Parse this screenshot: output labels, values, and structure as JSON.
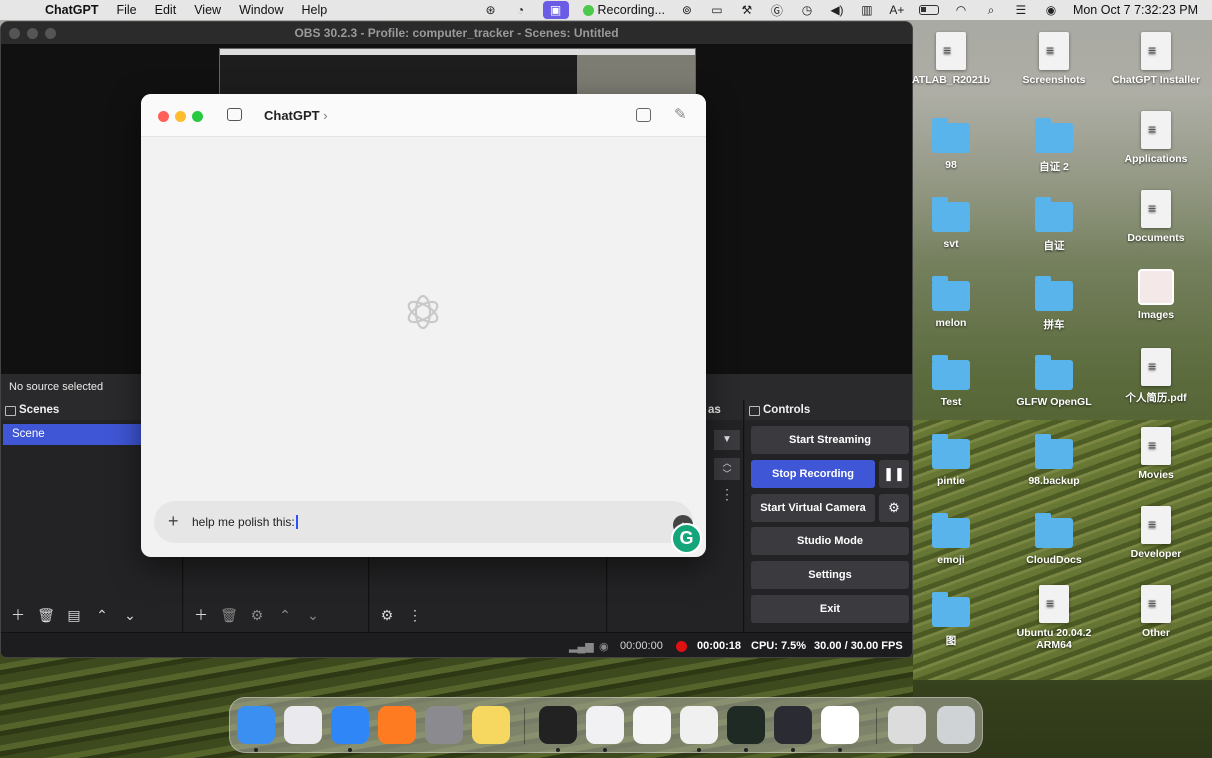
{
  "menubar": {
    "app_name": "ChatGPT",
    "menus": [
      "File",
      "Edit",
      "View",
      "Window",
      "Help"
    ],
    "recording_label": "Recording...",
    "datetime": "Mon Oct 7  7:32:23 PM"
  },
  "obs": {
    "window_title": "OBS 30.2.3 - Profile: computer_tracker - Scenes: Untitled",
    "source_status": "No source selected",
    "scenes_header": "Scenes",
    "scene_item": "Scene",
    "partial_header": "as",
    "controls_header": "Controls",
    "controls": {
      "start_streaming": "Start Streaming",
      "stop_recording": "Stop Recording",
      "start_virtual_camera": "Start Virtual Camera",
      "studio_mode": "Studio Mode",
      "settings": "Settings",
      "exit": "Exit"
    },
    "status": {
      "stream_time": "00:00:00",
      "rec_time": "00:00:18",
      "cpu": "CPU: 7.5%",
      "fps": "30.00 / 30.00 FPS"
    }
  },
  "chatgpt": {
    "title": "ChatGPT",
    "title_chevron": "›",
    "composer_text": "help me polish this:",
    "grammarly_letter": "G"
  },
  "desktop_icons": [
    {
      "label": "ATLAB_R2021b",
      "kind": "doc"
    },
    {
      "label": "Screenshots",
      "kind": "doc"
    },
    {
      "label": "ChatGPT Installer",
      "kind": "doc"
    },
    {
      "label": "98",
      "kind": "folder"
    },
    {
      "label": "自证 2",
      "kind": "folder"
    },
    {
      "label": "Applications",
      "kind": "doc"
    },
    {
      "label": "svt",
      "kind": "folder"
    },
    {
      "label": "自证",
      "kind": "folder"
    },
    {
      "label": "Documents",
      "kind": "doc"
    },
    {
      "label": "melon",
      "kind": "folder"
    },
    {
      "label": "拼车",
      "kind": "folder"
    },
    {
      "label": "Images",
      "kind": "image"
    },
    {
      "label": "Test",
      "kind": "folder"
    },
    {
      "label": "GLFW OpenGL",
      "kind": "folder"
    },
    {
      "label": "个人简历.pdf",
      "kind": "doc"
    },
    {
      "label": "pintie",
      "kind": "folder"
    },
    {
      "label": "98.backup",
      "kind": "folder"
    },
    {
      "label": "Movies",
      "kind": "doc"
    },
    {
      "label": "emoji",
      "kind": "folder"
    },
    {
      "label": "CloudDocs",
      "kind": "folder"
    },
    {
      "label": "Developer",
      "kind": "doc"
    },
    {
      "label": "图",
      "kind": "folder"
    },
    {
      "label": "Ubuntu 20.04.2 ARM64",
      "kind": "doc"
    },
    {
      "label": "Other",
      "kind": "doc"
    }
  ],
  "dock_apps": [
    {
      "name": "finder-icon",
      "color": "#3b8ff0"
    },
    {
      "name": "launchpad-icon",
      "color": "#e9e9ee"
    },
    {
      "name": "safari-icon",
      "color": "#2f86f6"
    },
    {
      "name": "firefox-icon",
      "color": "#ff7b22"
    },
    {
      "name": "system-settings-icon",
      "color": "#8a8a8f"
    },
    {
      "name": "notes-icon",
      "color": "#f6d860"
    },
    {
      "name": "terminal-icon",
      "color": "#222222"
    },
    {
      "name": "rocket-icon",
      "color": "#f1f1f4"
    },
    {
      "name": "textedit-icon",
      "color": "#f4f4f4"
    },
    {
      "name": "script-editor-icon",
      "color": "#f0f0f0"
    },
    {
      "name": "activity-monitor-icon",
      "color": "#1f2a24"
    },
    {
      "name": "obs-icon",
      "color": "#2b2b33"
    },
    {
      "name": "chatgpt-icon",
      "color": "#ffffff"
    },
    {
      "name": "document-stack-icon",
      "color": "#dcdcdc"
    },
    {
      "name": "trash-icon",
      "color": "#cfd3d6"
    }
  ]
}
